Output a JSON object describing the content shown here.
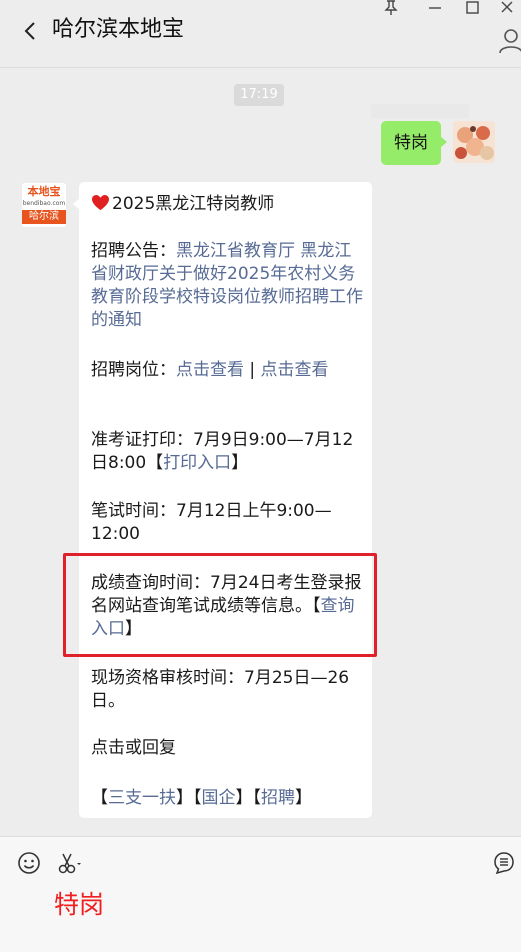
{
  "header": {
    "title": "哈尔滨本地宝"
  },
  "timestamp": "17:19",
  "outgoing": {
    "text": "特岗"
  },
  "bot": {
    "logo_top": "本地宝",
    "logo_sub": "bendibao.com",
    "logo_band": "哈尔滨"
  },
  "message": {
    "title": "2025黑龙江特岗教师",
    "notice_label": "招聘公告：",
    "notice_link": "黑龙江省教育厅 黑龙江省财政厅关于做好2025年农村义务教育阶段学校特设岗位教师招聘工作的通知",
    "position_label": "招聘岗位：",
    "position_link1": "点击查看",
    "position_sep": " | ",
    "position_link2": "点击查看",
    "admission_label": "准考证打印：7月9日9:00—7月12日8:00【",
    "admission_link": "打印入口",
    "admission_close": "】",
    "exam_text": "笔试时间：7月12日上午9:00—12:00",
    "score_text": "成绩查询时间：7月24日考生登录报名网站查询笔试成绩等信息。",
    "score_open": "【",
    "score_link": "查询入口",
    "score_close": "】",
    "review_text": "现场资格审核时间：7月25日—26日。",
    "reply_text": "点击或回复",
    "kw_open1": "【",
    "kw1": "三支一扶",
    "kw_close1": "】",
    "kw_open2": "【",
    "kw2": "国企",
    "kw_close2": "】",
    "kw_open3": "【",
    "kw3": "招聘",
    "kw_close3": "】"
  },
  "input": {
    "text": "特岗"
  },
  "colors": {
    "bubble_out": "#95ec69",
    "link": "#576b95",
    "highlight": "#e0212b",
    "input_text": "#f01e1e"
  }
}
